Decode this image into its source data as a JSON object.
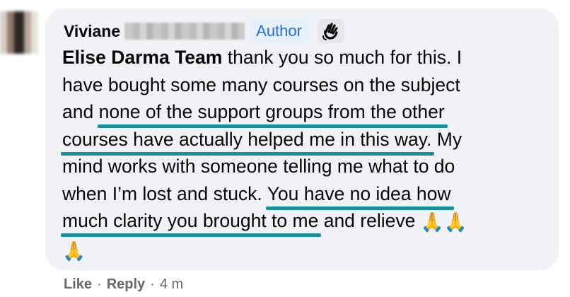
{
  "comment": {
    "author": "Viviane",
    "badge": "Author",
    "wave_icon": "waving-hand-icon",
    "mention": "Elise Darma Team",
    "lines": [
      " thank you so much for this. I",
      "have bought some many courses on the subject",
      "and ",
      "none of the support groups from the other",
      "courses have actually helped me in this way.",
      " My",
      "mind works with someone telling me what to do",
      "when I’m lost and stuck. ",
      "You have no idea how",
      "much clarity you brought to me",
      " and relieve "
    ],
    "emoji": "🙏",
    "underline_color": "#1a8f9a"
  },
  "actions": {
    "like": "Like",
    "separator": "·",
    "reply": "Reply",
    "time": "4 m"
  },
  "colors": {
    "bubble": "#f0f2f5",
    "badge_bg": "#e7f0fd",
    "badge_text": "#216fdb",
    "meta_text": "#65676b"
  }
}
